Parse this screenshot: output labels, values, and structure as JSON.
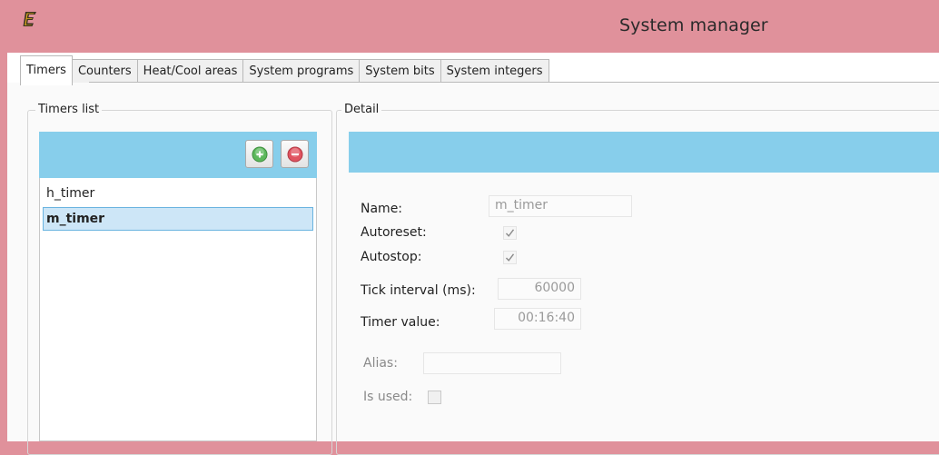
{
  "window": {
    "title": "System manager"
  },
  "tabs": [
    {
      "label": "Timers",
      "active": true
    },
    {
      "label": "Counters",
      "active": false
    },
    {
      "label": "Heat/Cool areas",
      "active": false
    },
    {
      "label": "System programs",
      "active": false
    },
    {
      "label": "System bits",
      "active": false
    },
    {
      "label": "System integers",
      "active": false
    }
  ],
  "timers_list": {
    "legend": "Timers list",
    "items": [
      {
        "name": "h_timer",
        "selected": false
      },
      {
        "name": "m_timer",
        "selected": true
      }
    ],
    "add_icon": "plus-circle-icon",
    "remove_icon": "minus-circle-icon"
  },
  "detail": {
    "legend": "Detail",
    "name_label": "Name:",
    "name_value": "m_timer",
    "autoreset_label": "Autoreset:",
    "autoreset_checked": true,
    "autostop_label": "Autostop:",
    "autostop_checked": true,
    "tick_label": "Tick interval (ms):",
    "tick_value": "60000",
    "timer_value_label": "Timer value:",
    "timer_value": "00:16:40",
    "alias_label": "Alias:",
    "alias_value": "",
    "is_used_label": "Is used:",
    "is_used_checked": false
  },
  "colors": {
    "titlebar": "#e0919b",
    "header_band": "#87ceeb",
    "selection": "#cde6f7",
    "add_button": "#5cb85c",
    "remove_button": "#e0535f"
  }
}
